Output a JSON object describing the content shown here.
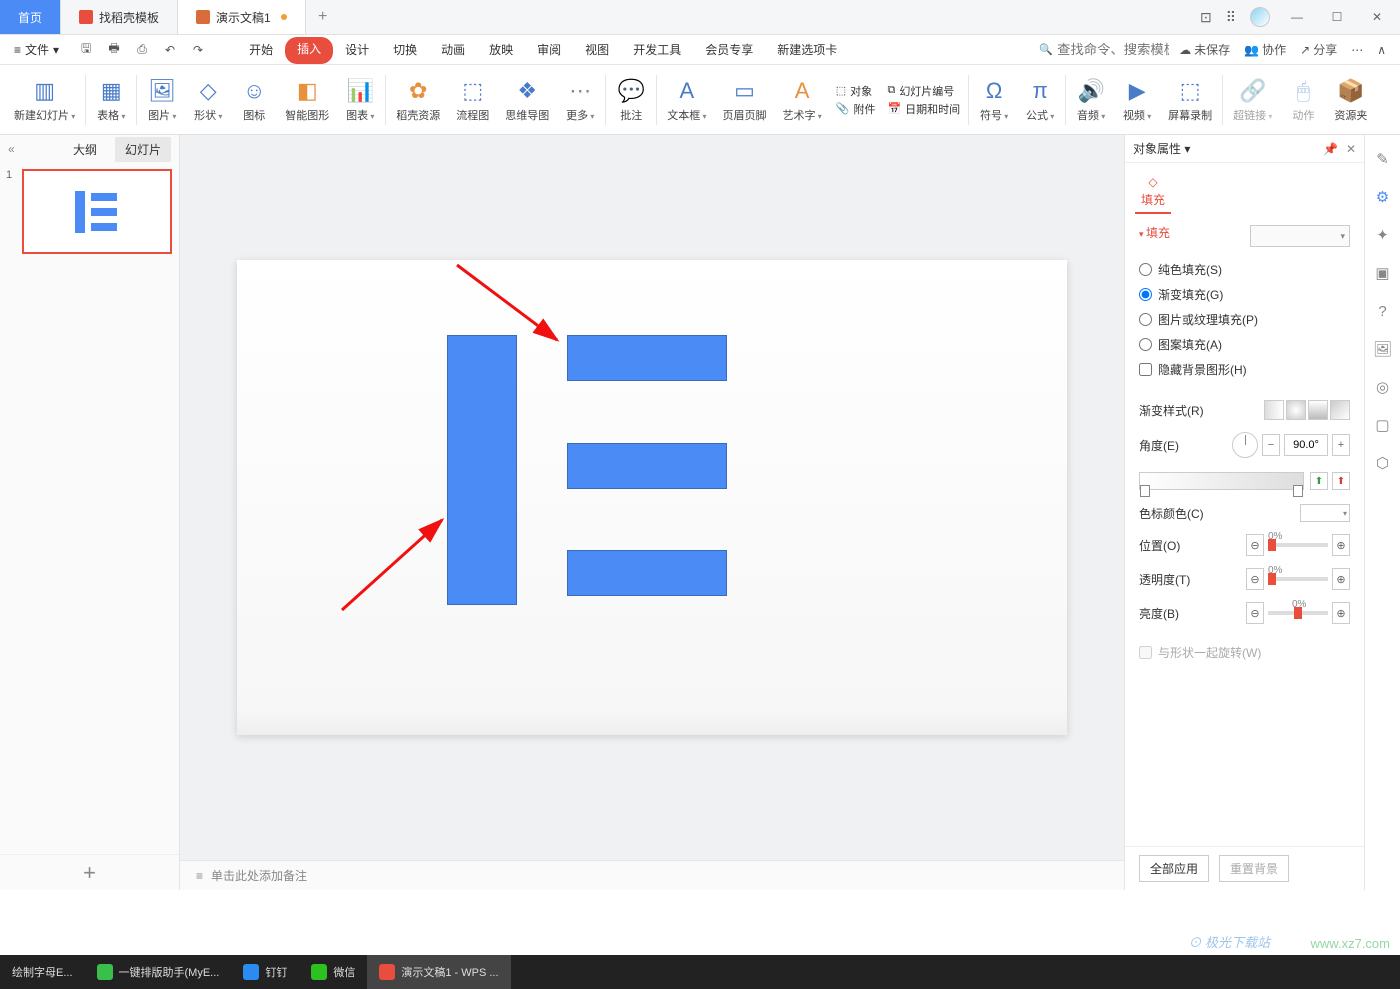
{
  "titlebar": {
    "tabs": [
      {
        "label": "首页",
        "type": "home"
      },
      {
        "label": "找稻壳模板",
        "type": "templates"
      },
      {
        "label": "演示文稿1",
        "type": "doc",
        "dirty": true
      }
    ]
  },
  "menubar": {
    "file": "文件",
    "tabs": [
      "开始",
      "插入",
      "设计",
      "切换",
      "动画",
      "放映",
      "审阅",
      "视图",
      "开发工具",
      "会员专享",
      "新建选项卡"
    ],
    "active_tab": "插入",
    "search_placeholder": "查找命令、搜索模板",
    "right": {
      "unsaved": "未保存",
      "collab": "协作",
      "share": "分享"
    }
  },
  "ribbon": {
    "items": [
      {
        "label": "新建幻灯片",
        "dd": true,
        "icon": "▦"
      },
      {
        "label": "表格",
        "dd": true,
        "icon": "▦"
      },
      {
        "label": "图片",
        "dd": true,
        "icon": "🖼"
      },
      {
        "label": "形状",
        "dd": true,
        "icon": "◇"
      },
      {
        "label": "图标",
        "icon": "☺"
      },
      {
        "label": "智能图形",
        "icon": "◧"
      },
      {
        "label": "图表",
        "dd": true,
        "icon": "📊"
      },
      {
        "label": "稻壳资源",
        "icon": "✿",
        "orange": true
      },
      {
        "label": "流程图",
        "icon": "⬚"
      },
      {
        "label": "思维导图",
        "icon": "❖"
      },
      {
        "label": "更多",
        "dd": true,
        "icon": "⋯"
      },
      {
        "label": "批注",
        "icon": "💬"
      },
      {
        "label": "文本框",
        "dd": true,
        "icon": "A"
      },
      {
        "label": "页眉页脚",
        "icon": "▭"
      },
      {
        "label": "艺术字",
        "dd": true,
        "icon": "A",
        "orange": true
      },
      {
        "label": "符号",
        "dd": true,
        "icon": "Ω"
      },
      {
        "label": "公式",
        "dd": true,
        "icon": "π"
      },
      {
        "label": "音频",
        "dd": true,
        "icon": "🔊"
      },
      {
        "label": "视频",
        "dd": true,
        "icon": "▶"
      },
      {
        "label": "屏幕录制",
        "icon": "⬚"
      },
      {
        "label": "超链接",
        "dd": true,
        "icon": "🔗",
        "dim": true
      },
      {
        "label": "动作",
        "icon": "🖱",
        "dim": true
      },
      {
        "label": "资源夹",
        "icon": "📦"
      }
    ],
    "side_group": {
      "object": "对象",
      "slide_num": "幻灯片编号",
      "attachment": "附件",
      "datetime": "日期和时间"
    }
  },
  "left_panel": {
    "tabs": {
      "outline": "大纲",
      "slides": "幻灯片"
    },
    "slide_num": "1"
  },
  "notes": {
    "placeholder": "单击此处添加备注"
  },
  "right_panel": {
    "title": "对象属性",
    "tab_fill": "填充",
    "section_fill": "填充",
    "fill_options": {
      "solid": "纯色填充(S)",
      "gradient": "渐变填充(G)",
      "picture": "图片或纹理填充(P)",
      "pattern": "图案填充(A)",
      "hide_bg": "隐藏背景图形(H)"
    },
    "gradient_style": "渐变样式(R)",
    "angle": "角度(E)",
    "angle_value": "90.0°",
    "stop_color": "色标颜色(C)",
    "position": "位置(O)",
    "position_value": "0%",
    "transparency": "透明度(T)",
    "transparency_value": "0%",
    "brightness": "亮度(B)",
    "brightness_value": "0%",
    "rotate_with_shape": "与形状一起旋转(W)",
    "apply_all": "全部应用",
    "reset_bg": "重置背景"
  },
  "taskbar": {
    "items": [
      {
        "label": "绘制字母E..."
      },
      {
        "label": "一键排版助手(MyE..."
      },
      {
        "label": "钉钉"
      },
      {
        "label": "微信"
      },
      {
        "label": "演示文稿1 - WPS ..."
      }
    ]
  },
  "watermarks": {
    "w1": "⊙ 极光下载站",
    "w2": "www.xz7.com"
  }
}
